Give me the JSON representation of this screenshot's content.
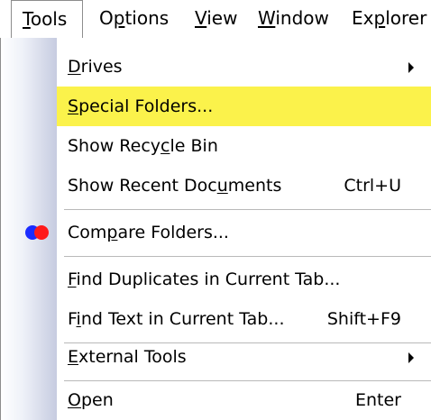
{
  "menubar": {
    "items": [
      {
        "label": "Tools",
        "accel": "T",
        "rest": "ools"
      },
      {
        "label": "Options",
        "pre": "O",
        "accel": "p",
        "rest": "tions"
      },
      {
        "label": "View",
        "accel": "V",
        "rest": "iew"
      },
      {
        "label": "Window",
        "accel": "W",
        "rest": "indow"
      },
      {
        "label": "Explorer",
        "pre": "Ex",
        "accel": "p",
        "rest": "lorer"
      }
    ]
  },
  "menu": {
    "items": [
      {
        "pre": "",
        "accel": "D",
        "rest": "rives",
        "shortcut": "",
        "submenu": true
      },
      {
        "pre": "",
        "accel": "S",
        "rest": "pecial Folders...",
        "shortcut": "",
        "highlighted": true
      },
      {
        "pre": "Show Recy",
        "accel": "c",
        "rest": "le Bin",
        "shortcut": ""
      },
      {
        "pre": "Show Recent Doc",
        "accel": "u",
        "rest": "ments",
        "shortcut": "Ctrl+U"
      },
      {
        "pre": "Com",
        "accel": "p",
        "rest": "are Folders...",
        "shortcut": "",
        "icon": "compare-icon"
      },
      {
        "pre": "",
        "accel": "F",
        "rest": "ind Duplicates in Current Tab...",
        "shortcut": ""
      },
      {
        "pre": "F",
        "accel": "i",
        "rest": "nd Text in Current Tab...",
        "shortcut": "Shift+F9"
      },
      {
        "pre": "",
        "accel": "E",
        "rest": "xternal Tools",
        "shortcut": "",
        "submenu": true
      },
      {
        "pre": "",
        "accel": "O",
        "rest": "pen",
        "shortcut": "Enter"
      }
    ]
  },
  "colors": {
    "highlight": "#fbf24b",
    "separator": "#b9b9b9",
    "icon_blue": "#1a2cff",
    "icon_red": "#ff1a1a"
  }
}
